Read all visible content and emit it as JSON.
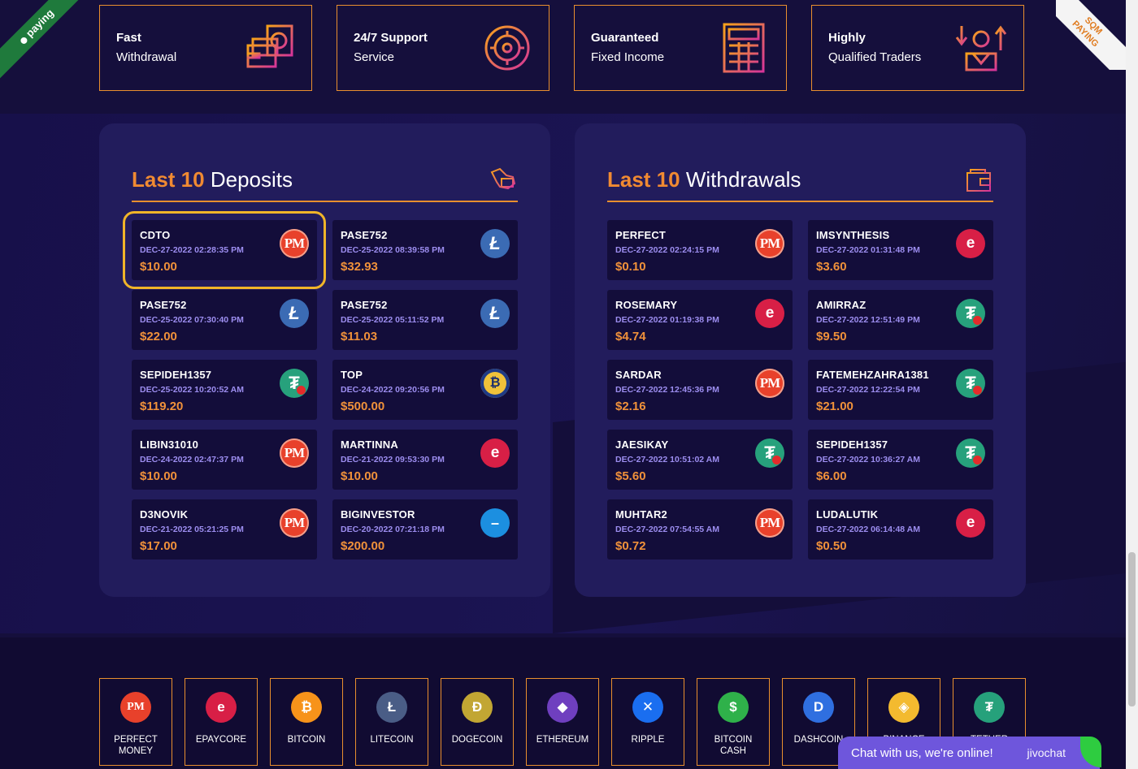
{
  "ribbons": {
    "left": "paying",
    "right_top": "SQM",
    "right_bottom": "PAYING"
  },
  "features": [
    {
      "line1": "Fast",
      "line2": "Withdrawal",
      "icon": "cash-icon"
    },
    {
      "line1": "24/7 Support",
      "line2": "Service",
      "icon": "support-gear-icon"
    },
    {
      "line1": "Guaranteed",
      "line2": "Fixed Income",
      "icon": "calculator-icon"
    },
    {
      "line1": "Highly",
      "line2": "Qualified Traders",
      "icon": "trader-icon"
    }
  ],
  "deposits": {
    "title_hl": "Last 10",
    "title_rest": "Deposits",
    "items": [
      {
        "name": "CDTO",
        "date": "DEC-27-2022 02:28:35 PM",
        "amount": "$10.00",
        "coin": "pm"
      },
      {
        "name": "PASE752",
        "date": "DEC-25-2022 08:39:58 PM",
        "amount": "$32.93",
        "coin": "ltc"
      },
      {
        "name": "PASE752",
        "date": "DEC-25-2022 07:30:40 PM",
        "amount": "$22.00",
        "coin": "ltc"
      },
      {
        "name": "PASE752",
        "date": "DEC-25-2022 05:11:52 PM",
        "amount": "$11.03",
        "coin": "ltc"
      },
      {
        "name": "SEPIDEH1357",
        "date": "DEC-25-2022 10:20:52 AM",
        "amount": "$119.20",
        "coin": "usdt"
      },
      {
        "name": "TOP",
        "date": "DEC-24-2022 09:20:56 PM",
        "amount": "$500.00",
        "coin": "btc"
      },
      {
        "name": "LIBIN31010",
        "date": "DEC-24-2022 02:47:37 PM",
        "amount": "$10.00",
        "coin": "pm"
      },
      {
        "name": "MARTINNA",
        "date": "DEC-21-2022 09:53:30 PM",
        "amount": "$10.00",
        "coin": "epay"
      },
      {
        "name": "D3NOVIK",
        "date": "DEC-21-2022 05:21:25 PM",
        "amount": "$17.00",
        "coin": "pm"
      },
      {
        "name": "BIGINVESTOR",
        "date": "DEC-20-2022 07:21:18 PM",
        "amount": "$200.00",
        "coin": "dash"
      }
    ]
  },
  "withdrawals": {
    "title_hl": "Last 10",
    "title_rest": "Withdrawals",
    "items": [
      {
        "name": "PERFECT",
        "date": "DEC-27-2022 02:24:15 PM",
        "amount": "$0.10",
        "coin": "pm"
      },
      {
        "name": "IMSYNTHESIS",
        "date": "DEC-27-2022 01:31:48 PM",
        "amount": "$3.60",
        "coin": "epay"
      },
      {
        "name": "ROSEMARY",
        "date": "DEC-27-2022 01:19:38 PM",
        "amount": "$4.74",
        "coin": "epay"
      },
      {
        "name": "AMIRRAZ",
        "date": "DEC-27-2022 12:51:49 PM",
        "amount": "$9.50",
        "coin": "usdt"
      },
      {
        "name": "SARDAR",
        "date": "DEC-27-2022 12:45:36 PM",
        "amount": "$2.16",
        "coin": "pm"
      },
      {
        "name": "FATEMEHZAHRA1381",
        "date": "DEC-27-2022 12:22:54 PM",
        "amount": "$21.00",
        "coin": "usdt"
      },
      {
        "name": "JAESIKAY",
        "date": "DEC-27-2022 10:51:02 AM",
        "amount": "$5.60",
        "coin": "usdt"
      },
      {
        "name": "SEPIDEH1357",
        "date": "DEC-27-2022 10:36:27 AM",
        "amount": "$6.00",
        "coin": "usdt"
      },
      {
        "name": "MUHTAR2",
        "date": "DEC-27-2022 07:54:55 AM",
        "amount": "$0.72",
        "coin": "pm"
      },
      {
        "name": "LUDALUTIK",
        "date": "DEC-27-2022 06:14:48 AM",
        "amount": "$0.50",
        "coin": "epay"
      }
    ]
  },
  "methods": [
    {
      "label": "PERFECT MONEY",
      "glyph": "PM",
      "color": "#e8412b"
    },
    {
      "label": "EPAYCORE",
      "glyph": "e",
      "color": "#d81f46"
    },
    {
      "label": "BITCOIN",
      "glyph": "₿",
      "color": "#f7931a"
    },
    {
      "label": "LITECOIN",
      "glyph": "Ł",
      "color": "#4a5d86"
    },
    {
      "label": "DOGECOIN",
      "glyph": "Ð",
      "color": "#c2a633"
    },
    {
      "label": "ETHEREUM",
      "glyph": "◆",
      "color": "#6f3fbf"
    },
    {
      "label": "RIPPLE",
      "glyph": "✕",
      "color": "#1a6ef0"
    },
    {
      "label": "BITCOIN CASH",
      "glyph": "$",
      "color": "#2fb14a"
    },
    {
      "label": "DASHCOIN",
      "glyph": "D",
      "color": "#2f6fe0"
    },
    {
      "label": "BINANCE",
      "glyph": "◈",
      "color": "#f3ba2f"
    },
    {
      "label": "TETHER",
      "glyph": "₮",
      "color": "#26a17b"
    }
  ],
  "chat": {
    "message": "Chat with us, we're online!",
    "brand": "jivochat"
  }
}
